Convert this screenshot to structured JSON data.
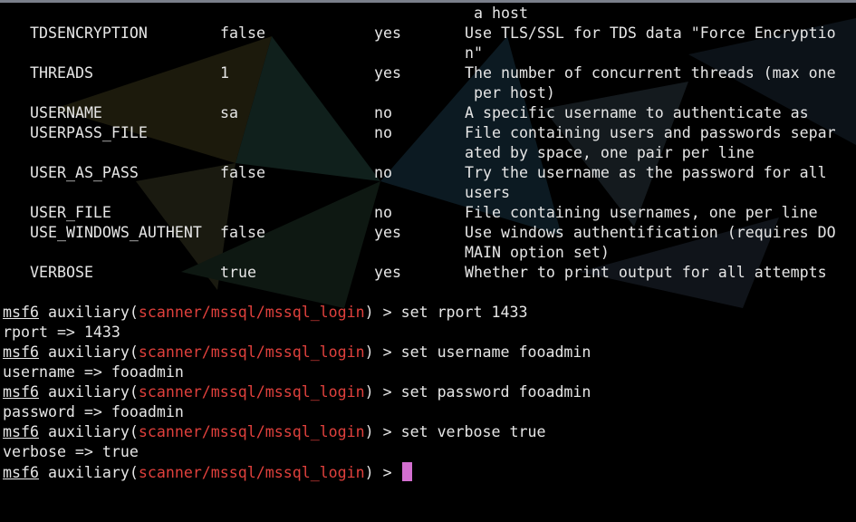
{
  "options": {
    "rows": [
      {
        "desc": [
          " a host"
        ]
      },
      {
        "name": "TDSENCRYPTION",
        "value": "false",
        "required": "yes",
        "desc": [
          "Use TLS/SSL for TDS data \"Force Encryptio",
          "n\""
        ]
      },
      {
        "name": "THREADS",
        "value": "1",
        "required": "yes",
        "desc": [
          "The number of concurrent threads (max one",
          " per host)"
        ]
      },
      {
        "name": "USERNAME",
        "value": "sa",
        "required": "no",
        "desc": [
          "A specific username to authenticate as"
        ]
      },
      {
        "name": "USERPASS_FILE",
        "value": "",
        "required": "no",
        "desc": [
          "File containing users and passwords separ",
          "ated by space, one pair per line"
        ]
      },
      {
        "name": "USER_AS_PASS",
        "value": "false",
        "required": "no",
        "desc": [
          "Try the username as the password for all",
          "users"
        ]
      },
      {
        "name": "USER_FILE",
        "value": "",
        "required": "no",
        "desc": [
          "File containing usernames, one per line"
        ]
      },
      {
        "name": "USE_WINDOWS_AUTHENT",
        "value": "false",
        "required": "yes",
        "desc": [
          "Use windows authentification (requires DO",
          "MAIN option set)"
        ]
      },
      {
        "name": "VERBOSE",
        "value": "true",
        "required": "yes",
        "desc": [
          "Whether to print output for all attempts"
        ]
      }
    ]
  },
  "prompt": {
    "prefix": "msf6",
    "context_open": " auxiliary(",
    "module": "scanner/mssql/mssql_login",
    "context_close": ") > "
  },
  "session": [
    {
      "command": "set rport 1433",
      "output": "rport => 1433"
    },
    {
      "command": "set username fooadmin",
      "output": "username => fooadmin"
    },
    {
      "command": "set password fooadmin",
      "output": "password => fooadmin"
    },
    {
      "command": "set verbose true",
      "output": "verbose => true"
    }
  ],
  "current_input": "",
  "colors": {
    "background": "#000000",
    "text": "#e6e6e6",
    "module": "#e0403c",
    "cursor": "#d36fd0"
  },
  "background_icon": "kali-dragon-watermark"
}
